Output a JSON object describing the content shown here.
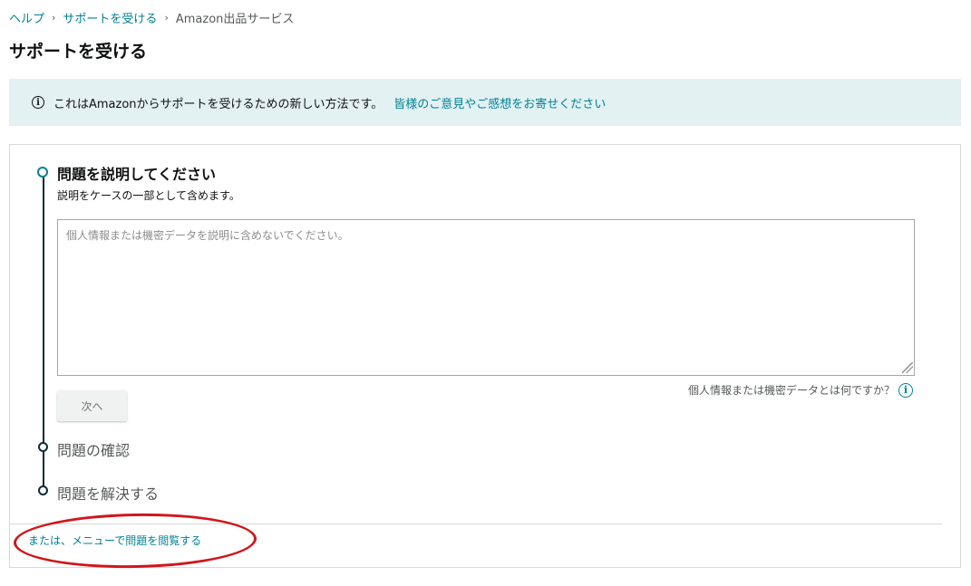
{
  "breadcrumb": {
    "items": [
      "ヘルプ",
      "サポートを受ける"
    ],
    "current": "Amazon出品サービス",
    "separator": "›"
  },
  "page_title": "サポートを受ける",
  "info_banner": {
    "icon": "info-icon",
    "icon_glyph": "i",
    "text": "これはAmazonからサポートを受けるための新しい方法です。",
    "link": "皆様のご意見やご感想をお寄せください"
  },
  "steps": {
    "step1": {
      "title": "問題を説明してください",
      "subtitle": "説明をケースの一部として含めます。",
      "description": {
        "placeholder": "個人情報または機密データを説明に含めないでください。",
        "value": ""
      },
      "next_button": "次へ",
      "sensitive_help_text": "個人情報または機密データとは何ですか？",
      "sensitive_help_icon": "i"
    },
    "step2": {
      "label": "問題の確認"
    },
    "step3": {
      "label": "問題を解決する"
    }
  },
  "browse_link": "または、メニューで問題を閲覧する",
  "colors": {
    "accent": "#008296",
    "banner_bg": "#e3f1f3",
    "annotation": "#d0161b"
  }
}
